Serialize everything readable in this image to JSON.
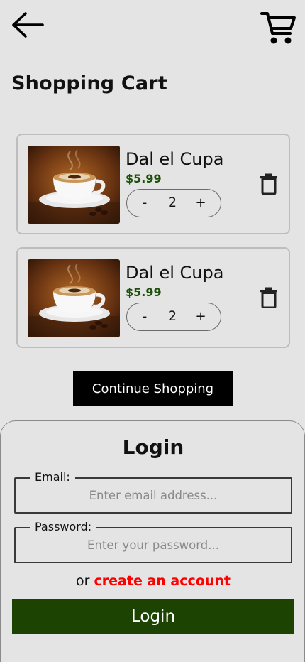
{
  "header": {
    "back_icon": "arrow-left-icon",
    "cart_icon": "shopping-cart-icon",
    "title": "Shopping Cart"
  },
  "cart": {
    "items": [
      {
        "name": "Dal el Cupa",
        "price": "$5.99",
        "quantity": "2",
        "minus": "-",
        "plus": "+",
        "image": "coffee-cup-image",
        "delete_icon": "trash-icon"
      },
      {
        "name": "Dal el Cupa",
        "price": "$5.99",
        "quantity": "2",
        "minus": "-",
        "plus": "+",
        "image": "coffee-cup-image",
        "delete_icon": "trash-icon"
      }
    ],
    "continue_label": "Continue Shopping"
  },
  "login": {
    "title": "Login",
    "email_label": "Email:",
    "email_value": "",
    "email_placeholder": "Enter email address...",
    "password_label": "Password:",
    "password_value": "",
    "password_placeholder": "Enter your password...",
    "alt_prefix": "or",
    "alt_link": "create an account",
    "submit_label": "Login"
  },
  "colors": {
    "background": "#e4e4e4",
    "price": "#1c5109",
    "link": "#ff0000",
    "login_button": "#1c4301",
    "continue_button": "#000000"
  }
}
